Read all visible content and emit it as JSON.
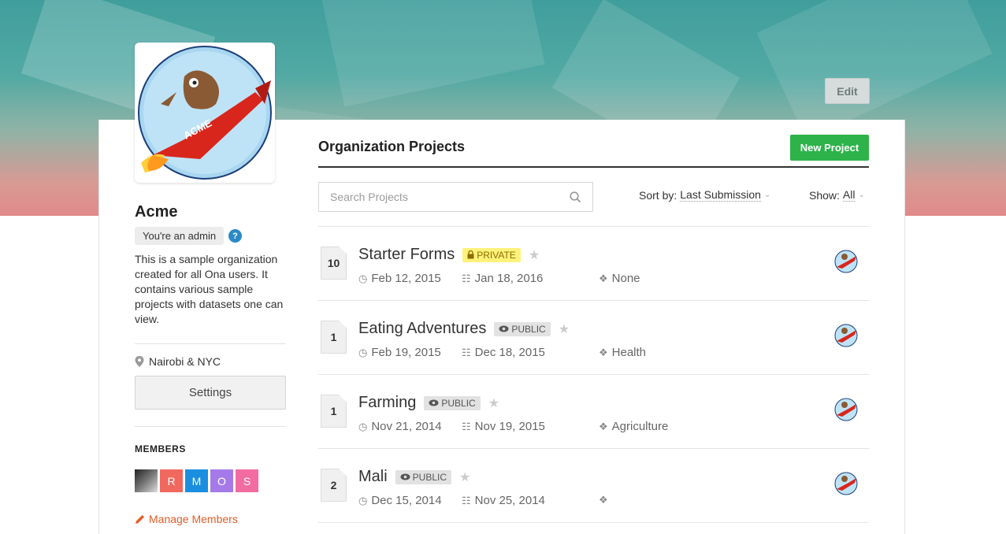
{
  "header": {
    "edit_label": "Edit"
  },
  "org": {
    "name": "Acme",
    "admin_badge": "You're an admin",
    "help": "?",
    "description": "This is a sample organization created for all Ona users. It contains various sample projects with datasets one can view.",
    "location": "Nairobi & NYC",
    "settings_label": "Settings",
    "members_title": "MEMBERS",
    "members": [
      {
        "initial": "",
        "color": "#555555",
        "type": "photo"
      },
      {
        "initial": "R",
        "color": "#f1685e"
      },
      {
        "initial": "M",
        "color": "#1a8fe0"
      },
      {
        "initial": "O",
        "color": "#a57ae8"
      },
      {
        "initial": "S",
        "color": "#f26ca1"
      }
    ],
    "manage_label": "Manage Members"
  },
  "projects": {
    "title": "Organization Projects",
    "new_label": "New Project",
    "search_placeholder": "Search Projects",
    "sort_label": "Sort by:",
    "sort_value": "Last Submission",
    "show_label": "Show:",
    "show_value": "All",
    "rows": [
      {
        "count": "10",
        "name": "Starter Forms",
        "badge": "PRIVATE",
        "created": "Feb 12, 2015",
        "modified": "Jan 18, 2016",
        "tag": "None"
      },
      {
        "count": "1",
        "name": "Eating Adventures",
        "badge": "PUBLIC",
        "created": "Feb 19, 2015",
        "modified": "Dec 18, 2015",
        "tag": "Health"
      },
      {
        "count": "1",
        "name": "Farming",
        "badge": "PUBLIC",
        "created": "Nov 21, 2014",
        "modified": "Nov 19, 2015",
        "tag": "Agriculture"
      },
      {
        "count": "2",
        "name": "Mali",
        "badge": "PUBLIC",
        "created": "Dec 15, 2014",
        "modified": "Nov 25, 2014",
        "tag": ""
      }
    ]
  },
  "colors": {
    "accent_green": "#2db34a",
    "link_orange": "#e25d26",
    "help_blue": "#2a8ac8",
    "private_yellow": "#fff27a"
  },
  "icons": {
    "clock": "clock-icon",
    "document": "document-icon",
    "tag": "tag-icon",
    "lock": "lock-icon",
    "eye": "eye-icon",
    "star": "star-icon",
    "search": "search-icon",
    "pencil": "pencil-icon",
    "pin": "map-pin-icon"
  }
}
